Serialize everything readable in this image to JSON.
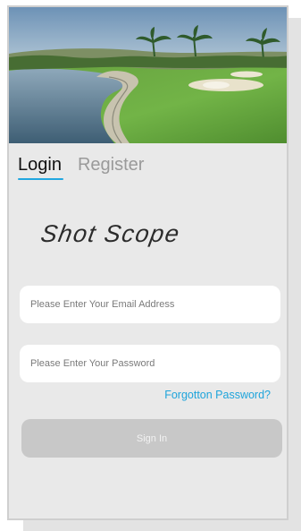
{
  "tabs": {
    "login": "Login",
    "register": "Register"
  },
  "brand": {
    "logo_text": "Shot Scope"
  },
  "form": {
    "email_placeholder": "Please Enter Your Email Address",
    "password_placeholder": "Please Enter Your Password",
    "forgot_password": "Forgotton Password?",
    "sign_in_label": "Sign In"
  },
  "colors": {
    "accent": "#1ea4db",
    "background": "#e9e9e9",
    "button_disabled": "#c8c8c8"
  }
}
